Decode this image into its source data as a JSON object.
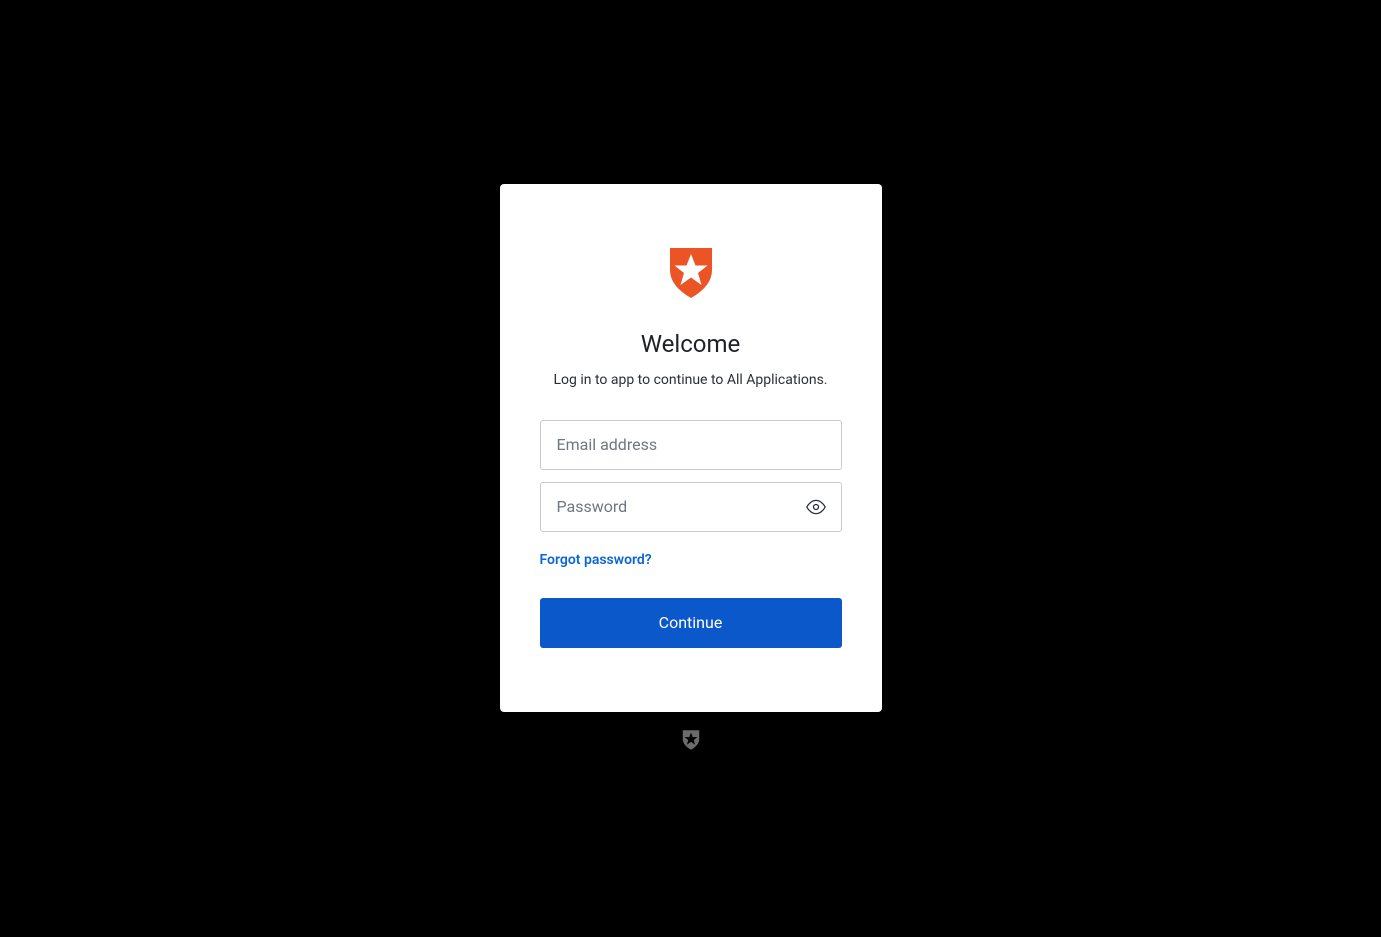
{
  "heading": "Welcome",
  "subheading": "Log in to app to continue to All Applications.",
  "email": {
    "placeholder": "Email address",
    "value": ""
  },
  "password": {
    "placeholder": "Password",
    "value": ""
  },
  "forgot_password_label": "Forgot password?",
  "continue_label": "Continue",
  "colors": {
    "primary_button": "#0a58ca",
    "link": "#0a66d6",
    "logo": "#eb5424",
    "footer_logo": "#6b6b6b"
  }
}
